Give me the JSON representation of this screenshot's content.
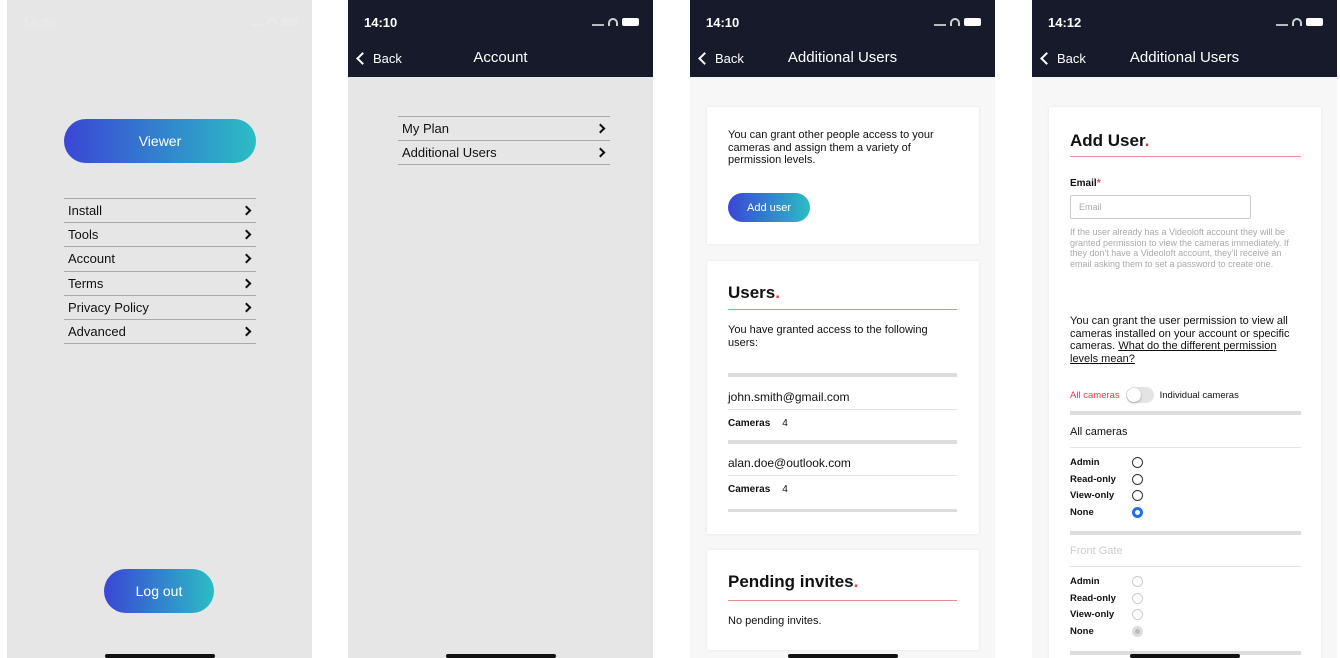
{
  "panel1": {
    "status_time": "14:09",
    "viewer_label": "Viewer",
    "menu": [
      {
        "label": "Install"
      },
      {
        "label": "Tools"
      },
      {
        "label": "Account"
      },
      {
        "label": "Terms"
      },
      {
        "label": "Privacy Policy"
      },
      {
        "label": "Advanced"
      }
    ],
    "logout_label": "Log out"
  },
  "panel2": {
    "status_time": "14:10",
    "back_label": "Back",
    "title": "Account",
    "menu": [
      {
        "label": "My Plan"
      },
      {
        "label": "Additional Users"
      }
    ]
  },
  "panel3": {
    "status_time": "14:10",
    "back_label": "Back",
    "title": "Additional Users",
    "intro_text": "You can grant other people access to your cameras and assign them a variety of permission levels.",
    "add_user_label": "Add user",
    "users_heading": "Users",
    "users_desc": "You have granted access to the following users:",
    "users": [
      {
        "email": "john.smith@gmail.com",
        "cameras_label": "Cameras",
        "cameras_count": "4"
      },
      {
        "email": "alan.doe@outlook.com",
        "cameras_label": "Cameras",
        "cameras_count": "4"
      }
    ],
    "pending_heading": "Pending invites",
    "pending_text": "No pending invites."
  },
  "panel4": {
    "status_time": "14:12",
    "back_label": "Back",
    "title": "Additional Users",
    "heading": "Add User",
    "email_label": "Email",
    "email_required": "*",
    "email_placeholder": "Email",
    "hint_text": "If the user already has a Videoloft account they will be granted permission to view the cameras immediately. If they don't have a Videoloft account, they'll receive an email asking them to set a password to create one.",
    "permission_text": "You can grant the user permission to view all cameras installed on your account or specific cameras.",
    "permission_link": "What do the different permission levels mean?",
    "toggle_left": "All cameras",
    "toggle_right": "Individual cameras",
    "group1_title": "All cameras",
    "group2_title": "Front Gate",
    "levels": [
      {
        "label": "Admin"
      },
      {
        "label": "Read-only"
      },
      {
        "label": "View-only"
      },
      {
        "label": "None"
      }
    ],
    "selected_level": "None"
  },
  "colors": {
    "navbar": "#171a2b",
    "gradient_start": "#3a46d6",
    "gradient_end": "#2bbdc4",
    "accent_red": "#e53d4e",
    "radio_blue": "#1e6fe8"
  }
}
